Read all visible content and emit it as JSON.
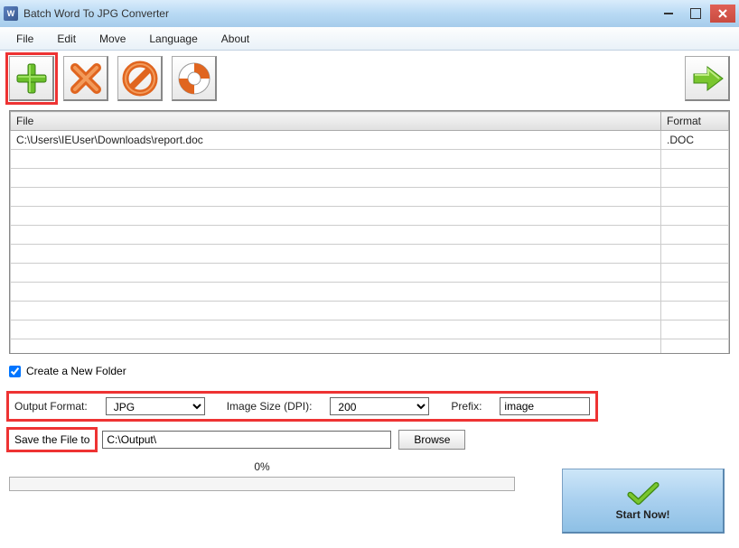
{
  "window": {
    "title": "Batch Word To JPG Converter"
  },
  "menu": [
    "File",
    "Edit",
    "Move",
    "Language",
    "About"
  ],
  "table": {
    "headers": {
      "file": "File",
      "format": "Format"
    },
    "rows": [
      {
        "file": "C:\\Users\\IEUser\\Downloads\\report.doc",
        "format": ".DOC"
      }
    ]
  },
  "checkbox": {
    "label": "Create a New Folder",
    "checked": true
  },
  "output": {
    "format_label": "Output Format:",
    "format_value": "JPG",
    "dpi_label": "Image Size (DPI):",
    "dpi_value": "200",
    "prefix_label": "Prefix:",
    "prefix_value": "image"
  },
  "save": {
    "label": "Save the File to",
    "path": "C:\\Output\\",
    "browse": "Browse"
  },
  "progress": {
    "pct": "0%"
  },
  "start": {
    "label": "Start Now!"
  }
}
